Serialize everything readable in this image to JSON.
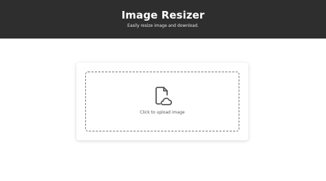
{
  "header": {
    "title": "Image Resizer",
    "subtitle": "Easily resize image and download."
  },
  "upload": {
    "icon": "file-cloud-upload-icon",
    "label": "Click to upload image"
  },
  "colors": {
    "header_bg": "#2e2e2e",
    "header_text": "#ffffff",
    "page_bg": "#ffffff",
    "dashed_border": "#6f6f6f",
    "icon": "#555555"
  }
}
